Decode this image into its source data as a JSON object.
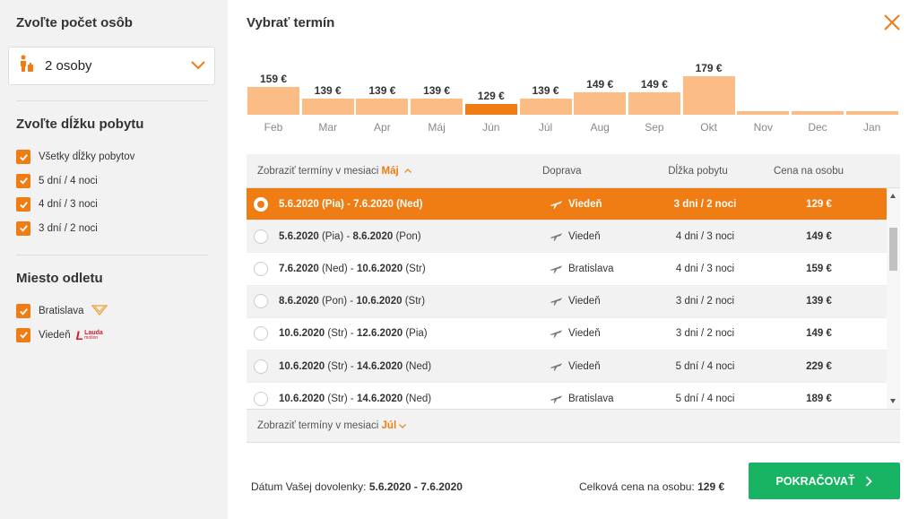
{
  "sidebar": {
    "persons_title": "Zvoľte počet osôb",
    "persons_value": "2 osoby",
    "duration_title": "Zvoľte dĺžku pobytu",
    "durations": [
      {
        "label": "Všetky dĺžky pobytov",
        "checked": true
      },
      {
        "label": "5 dní / 4 noci",
        "checked": true
      },
      {
        "label": "4 dní / 3 noci",
        "checked": true
      },
      {
        "label": "3 dní / 2 noci",
        "checked": true
      }
    ],
    "departure_title": "Miesto odletu",
    "departures": [
      {
        "label": "Bratislava",
        "checked": true,
        "logo": "ryanair-logo"
      },
      {
        "label": "Viedeň",
        "checked": true,
        "logo": "lauda-logo"
      }
    ],
    "lauda_logo_text": "Lauda",
    "lauda_logo_sub": "motion"
  },
  "main": {
    "title": "Vybrať termín",
    "accent_color": "#f07c14",
    "bar_color": "#fbbd85",
    "green_color": "#19b463"
  },
  "chart_data": {
    "type": "bar",
    "categories": [
      "Feb",
      "Mar",
      "Apr",
      "Máj",
      "Jún",
      "Júl",
      "Aug",
      "Sep",
      "Okt",
      "Nov",
      "Dec",
      "Jan"
    ],
    "values": [
      159,
      139,
      139,
      139,
      129,
      139,
      149,
      149,
      179,
      null,
      null,
      null
    ],
    "labels": [
      "159 €",
      "139 €",
      "139 €",
      "139 €",
      "129 €",
      "139 €",
      "149 €",
      "149 €",
      "179 €",
      "",
      "",
      ""
    ],
    "selected": "Jún",
    "title": "",
    "xlabel": "",
    "ylabel": ""
  },
  "table": {
    "header_prefix": "Zobraziť termíny v mesiaci",
    "header_month": "Máj",
    "col_transport": "Doprava",
    "col_duration": "Dĺžka pobytu",
    "col_price": "Cena na osobu",
    "footer_prefix": "Zobraziť termíny v mesiaci",
    "footer_month": "Júl",
    "rows": [
      {
        "from": "5.6.2020",
        "from_day": "(Pia)",
        "to": "7.6.2020",
        "to_day": "(Ned)",
        "transport": "Viedeň",
        "duration": "3 dni  / 2 noci",
        "price": "129 €",
        "selected": true
      },
      {
        "from": "5.6.2020",
        "from_day": "(Pia)",
        "to": "8.6.2020",
        "to_day": "(Pon)",
        "transport": "Viedeň",
        "duration": "4 dni  / 3 noci",
        "price": "149 €",
        "selected": false
      },
      {
        "from": "7.6.2020",
        "from_day": "(Ned)",
        "to": "10.6.2020",
        "to_day": "(Str)",
        "transport": "Bratislava",
        "duration": "4 dni  / 3 noci",
        "price": "159 €",
        "selected": false
      },
      {
        "from": "8.6.2020",
        "from_day": "(Pon)",
        "to": "10.6.2020",
        "to_day": "(Str)",
        "transport": "Viedeň",
        "duration": "3 dni  / 2 noci",
        "price": "139 €",
        "selected": false
      },
      {
        "from": "10.6.2020",
        "from_day": "(Str)",
        "to": "12.6.2020",
        "to_day": "(Pia)",
        "transport": "Viedeň",
        "duration": "3 dni  / 2 noci",
        "price": "149 €",
        "selected": false
      },
      {
        "from": "10.6.2020",
        "from_day": "(Str)",
        "to": "14.6.2020",
        "to_day": "(Ned)",
        "transport": "Viedeň",
        "duration": "5 dní  / 4 noci",
        "price": "229 €",
        "selected": false
      },
      {
        "from": "10.6.2020",
        "from_day": "(Str)",
        "to": "14.6.2020",
        "to_day": "(Ned)",
        "transport": "Bratislava",
        "duration": "5 dní  / 4 noci",
        "price": "189 €",
        "selected": false
      }
    ]
  },
  "summary": {
    "date_label": "Dátum Vašej dovolenky:",
    "date_value": "5.6.2020 - 7.6.2020",
    "price_label": "Celková cena na osobu:",
    "price_value": "129 €",
    "continue_label": "POKRAČOVAŤ"
  }
}
